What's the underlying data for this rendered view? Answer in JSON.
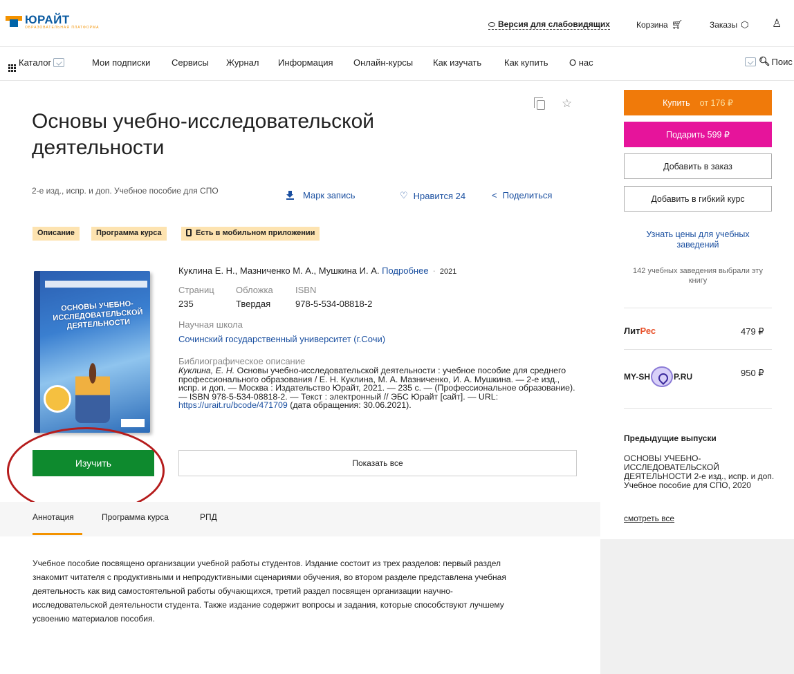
{
  "header": {
    "logo_text": "ЮРАЙТ",
    "logo_subtext": "ОБРАЗОВАТЕЛЬНАЯ ПЛАТФОРМА",
    "accessible_version": "Версия для слабовидящих",
    "cart": "Корзина",
    "orders": "Заказы"
  },
  "nav": {
    "catalog": "Каталог",
    "items": [
      "Мои подписки",
      "Сервисы",
      "Журнал",
      "Информация",
      "Онлайн-курсы",
      "Как изучать",
      "Как купить",
      "О нас"
    ],
    "search": "Поис"
  },
  "book": {
    "title": "Основы учебно-исследовательской деятельности",
    "subtitle": "2-е изд., испр. и доп. Учебное пособие для СПО",
    "marc": "Марк запись",
    "likes": "Нравится 24",
    "share": "Поделиться",
    "tags": [
      "Описание",
      "Программа курса",
      "Есть в мобильном приложении"
    ],
    "authors": "Куклина Е. Н., Мазниченко М. А., Мушкина И. А.",
    "more_link": "Подробнее",
    "year": "2021",
    "cover_title": "ОСНОВЫ УЧЕБНО-ИССЛЕДОВАТЕЛЬСКОЙ ДЕЯТЕЛЬНОСТИ",
    "pages_label": "Страниц",
    "cover_label": "Обложка",
    "isbn_label": "ISBN",
    "pages": "235",
    "binding": "Твердая",
    "isbn": "978-5-534-08818-2",
    "school_label": "Научная школа",
    "school": "Сочинский государственный университет (г.Сочи)",
    "biblio_label": "Библиографическое описание",
    "biblio_author": "Куклина, Е. Н.",
    "biblio_text": " Основы учебно-исследовательской деятельности : учебное пособие для среднего профессионального образования / Е. Н. Куклина, М. А. Мазниченко, И. А. Мушкина. — 2-е изд., испр. и доп. — Москва : Издательство Юрайт, 2021. — 235 с. — (Профессиональное образование). — ISBN 978-5-534-08818-2. — Текст : электронный // ЭБС Юрайт [сайт]. — URL: ",
    "biblio_url": "https://urait.ru/bcode/471709",
    "biblio_tail": " (дата обращения: 30.06.2021).",
    "study_button": "Изучить",
    "show_all_button": "Показать все"
  },
  "tabs": [
    "Аннотация",
    "Программа курса",
    "РПД"
  ],
  "annotation": "Учебное пособие посвящено организации учебной работы студентов. Издание состоит из трех разделов: первый раздел знакомит читателя с продуктивными и непродуктивными сценариями обучения, во втором разделе представлена учебная деятельность как вид самостоятельной работы обучающихся, третий раздел посвящен организации научно-исследовательской деятельности студента. Также издание содержит вопросы и задания, которые способствуют лучшему усвоению материалов пособия.",
  "sidebar": {
    "buy": "Купить",
    "buy_price": "от 176 ₽",
    "gift": "Подарить 599 ₽",
    "add_order": "Добавить в заказ",
    "add_course": "Добавить в гибкий курс",
    "institution_prices": "Узнать цены для учебных заведений",
    "institutions_chose": "142 учебных заведения выбрали эту книгу",
    "litres_lit": "Лит",
    "litres_res": "Рес",
    "litres_price": "479 ₽",
    "myshop_left": "MY-SH",
    "myshop_right": "P.RU",
    "myshop_price": "950 ₽",
    "prev_title": "Предыдущие выпуски",
    "prev_text": "ОСНОВЫ УЧЕБНО-ИССЛЕДОВАТЕЛЬСКОЙ ДЕЯТЕЛЬНОСТИ 2-е изд., испр. и доп. Учебное пособие для СПО, 2020",
    "see_all": "смотреть все"
  },
  "colors": {
    "accent_orange": "#f07a0a",
    "gift_pink": "#e6149b",
    "study_green": "#0e8a2e",
    "link_blue": "#1a4fa0",
    "tag_bg": "#fde3b0",
    "annotation_red": "#b51c1c"
  }
}
